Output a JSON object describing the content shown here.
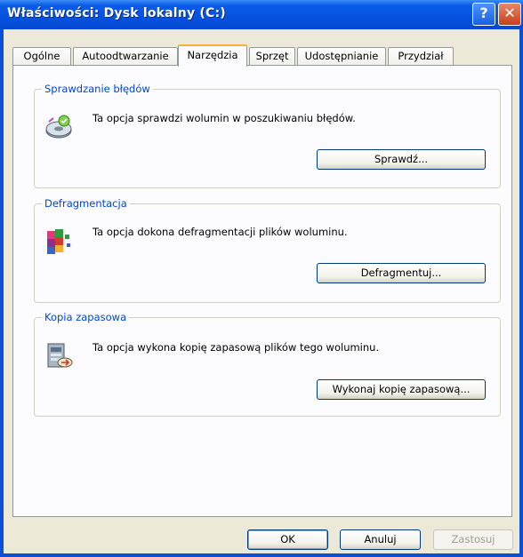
{
  "window": {
    "title": "Właściwości: Dysk lokalny (C:)",
    "help_label": "?",
    "close_label": "✕"
  },
  "tabs": [
    {
      "label": "Ogólne"
    },
    {
      "label": "Autoodtwarzanie"
    },
    {
      "label": "Narzędzia",
      "active": true
    },
    {
      "label": "Sprzęt"
    },
    {
      "label": "Udostępnianie"
    },
    {
      "label": "Przydział"
    }
  ],
  "groups": {
    "check": {
      "title": "Sprawdzanie błędów",
      "text": "Ta opcja sprawdzi wolumin w poszukiwaniu błędów.",
      "button": "Sprawdź...",
      "icon": "disk-check-icon"
    },
    "defrag": {
      "title": "Defragmentacja",
      "text": "Ta opcja dokona defragmentacji plików woluminu.",
      "button": "Defragmentuj...",
      "icon": "defragment-icon"
    },
    "backup": {
      "title": "Kopia zapasowa",
      "text": "Ta opcja wykona kopię zapasową plików tego woluminu.",
      "button": "Wykonaj kopię zapasową...",
      "icon": "backup-icon"
    }
  },
  "footer": {
    "ok": "OK",
    "cancel": "Anuluj",
    "apply": "Zastosuj"
  },
  "colors": {
    "titlebar": "#0452df",
    "dialog_bg": "#ece9d8",
    "group_title": "#0046d5",
    "active_tab_accent": "#f1b438"
  }
}
